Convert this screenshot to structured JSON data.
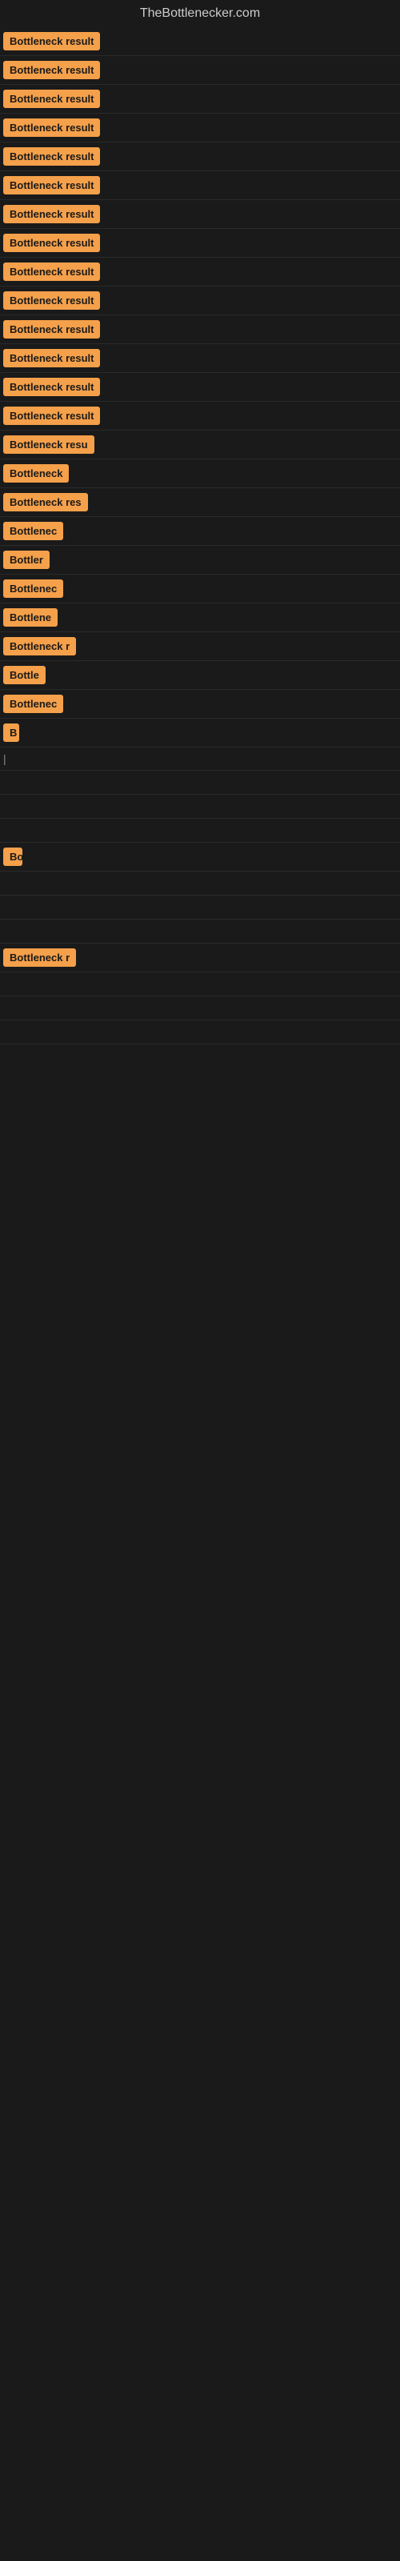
{
  "site": {
    "title": "TheBottlenecker.com"
  },
  "items": [
    {
      "label": "Bottleneck result",
      "width": 145
    },
    {
      "label": "Bottleneck result",
      "width": 145
    },
    {
      "label": "Bottleneck result",
      "width": 145
    },
    {
      "label": "Bottleneck result",
      "width": 145
    },
    {
      "label": "Bottleneck result",
      "width": 145
    },
    {
      "label": "Bottleneck result",
      "width": 145
    },
    {
      "label": "Bottleneck result",
      "width": 145
    },
    {
      "label": "Bottleneck result",
      "width": 145
    },
    {
      "label": "Bottleneck result",
      "width": 145
    },
    {
      "label": "Bottleneck result",
      "width": 145
    },
    {
      "label": "Bottleneck result",
      "width": 145
    },
    {
      "label": "Bottleneck result",
      "width": 145
    },
    {
      "label": "Bottleneck result",
      "width": 145
    },
    {
      "label": "Bottleneck result",
      "width": 145
    },
    {
      "label": "Bottleneck resu",
      "width": 120
    },
    {
      "label": "Bottleneck",
      "width": 88
    },
    {
      "label": "Bottleneck res",
      "width": 110
    },
    {
      "label": "Bottlenec",
      "width": 80
    },
    {
      "label": "Bottler",
      "width": 60
    },
    {
      "label": "Bottlenec",
      "width": 80
    },
    {
      "label": "Bottlene",
      "width": 72
    },
    {
      "label": "Bottleneck r",
      "width": 95
    },
    {
      "label": "Bottle",
      "width": 55
    },
    {
      "label": "Bottlenec",
      "width": 80
    },
    {
      "label": "B",
      "width": 20
    },
    {
      "label": "|",
      "width": 10
    },
    {
      "label": "",
      "width": 0
    },
    {
      "label": "",
      "width": 0
    },
    {
      "label": "",
      "width": 0
    },
    {
      "label": "Bo",
      "width": 24
    },
    {
      "label": "",
      "width": 0
    },
    {
      "label": "",
      "width": 0
    },
    {
      "label": "",
      "width": 0
    },
    {
      "label": "Bottleneck r",
      "width": 95
    },
    {
      "label": "",
      "width": 0
    },
    {
      "label": "",
      "width": 0
    },
    {
      "label": "",
      "width": 0
    }
  ]
}
